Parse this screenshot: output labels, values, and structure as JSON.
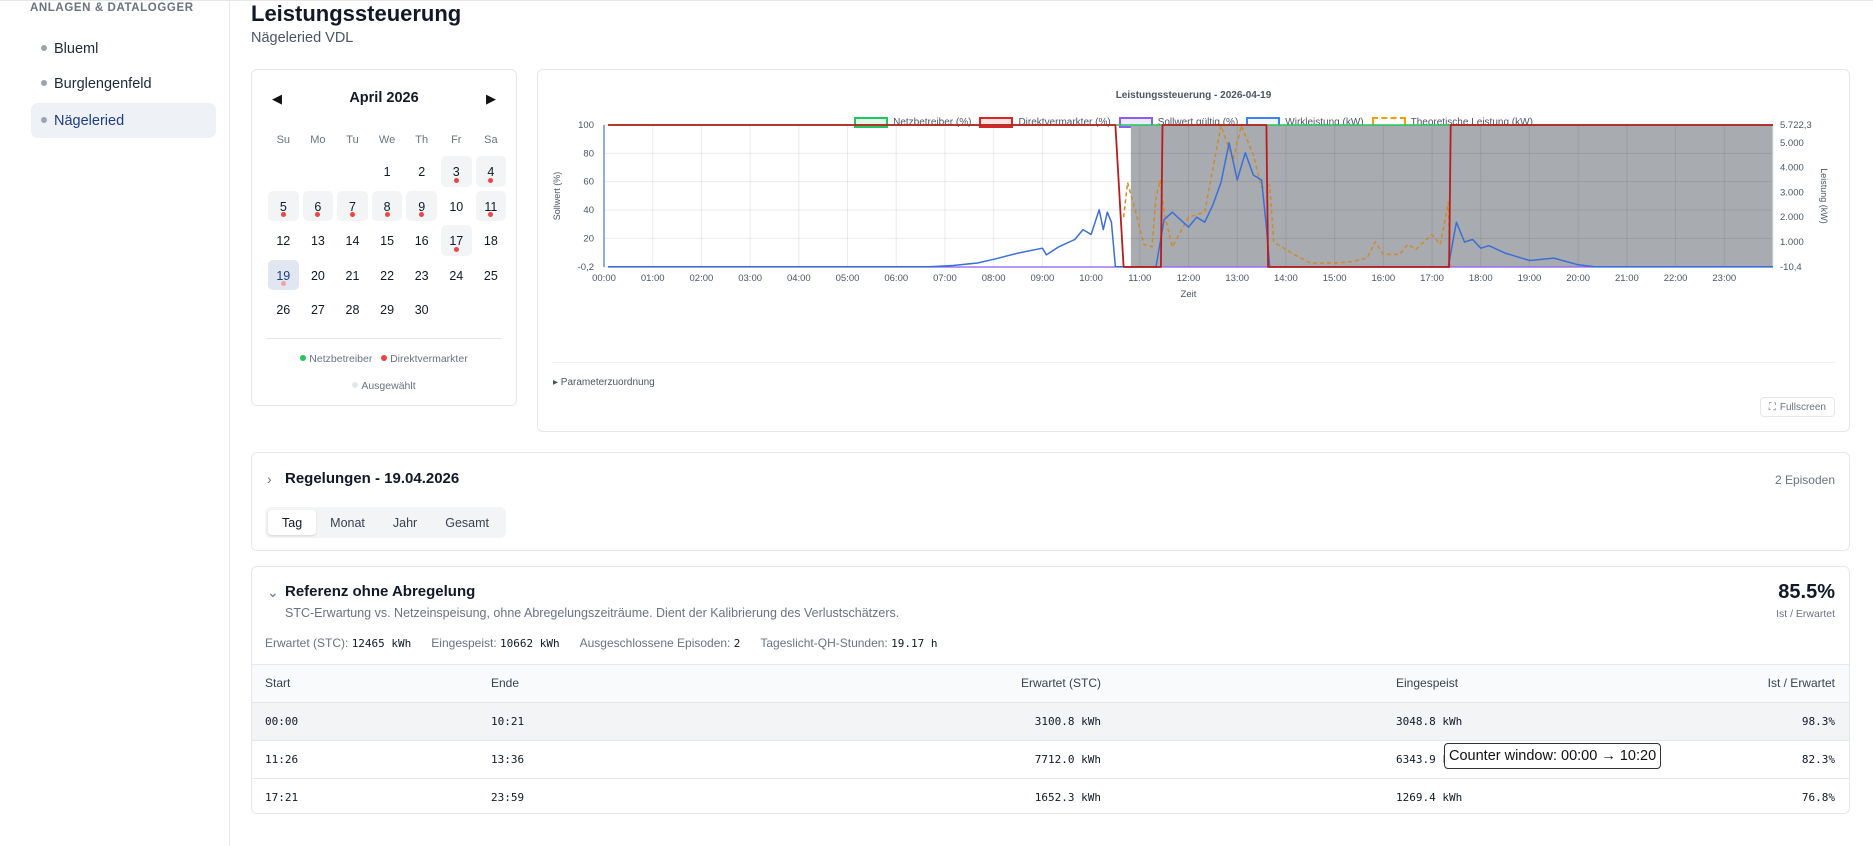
{
  "sidebar": {
    "heading": "ANLAGEN & DATALOGGER",
    "items": [
      {
        "label": "Blueml"
      },
      {
        "label": "Burglengenfeld"
      },
      {
        "label": "Nägeleried"
      }
    ]
  },
  "header": {
    "title": "Leistungssteuerung",
    "subtitle": "Nägeleried VDL"
  },
  "calendar": {
    "month": "April 2026",
    "prev": "◀",
    "next": "▶",
    "weekdays": [
      "Su",
      "Mo",
      "Tu",
      "We",
      "Th",
      "Fr",
      "Sa"
    ],
    "legend": {
      "netz": "Netzbetreiber",
      "direkt": "Direktvermarkter",
      "sel": "Ausgewählt"
    },
    "colors": {
      "netz": "#22c55e",
      "direkt": "#ef4444"
    }
  },
  "chart": {
    "title": "Leistungssteuerung - 2026-04-19",
    "param_toggle": "▸ Parameterzuordnung",
    "fullscreen": "Fullscreen",
    "legend": [
      {
        "name": "Netzbetreiber (%)",
        "color": "#22c55e",
        "fill": "#dcfce7",
        "dash": false
      },
      {
        "name": "Direktvermarkter (%)",
        "color": "#dc2626",
        "fill": "#fee2e2",
        "dash": false
      },
      {
        "name": "Sollwert gültig (%)",
        "color": "#8b5cf6",
        "fill": "#ede9fe",
        "dash": false
      },
      {
        "name": "Wirkleistung (kW)",
        "color": "#3b82f6",
        "fill": "#eff6ff",
        "dash": false
      },
      {
        "name": "Theoretische Leistung (kW)",
        "color": "#f59e0b",
        "fill": "#fff",
        "dash": true
      }
    ]
  },
  "chart_data": {
    "type": "line",
    "title": "Leistungssteuerung - 2026-04-19",
    "xlabel": "Zeit",
    "ylabel": "Sollwert (%)",
    "y2label": "Leistung (kW)",
    "x_ticks": [
      "00:00",
      "01:00",
      "02:00",
      "03:00",
      "04:00",
      "05:00",
      "06:00",
      "07:00",
      "08:00",
      "09:00",
      "10:00",
      "11:00",
      "12:00",
      "13:00",
      "14:00",
      "15:00",
      "16:00",
      "17:00",
      "18:00",
      "19:00",
      "20:00",
      "21:00",
      "22:00",
      "23:00"
    ],
    "y_ticks": [
      "100",
      "80",
      "60",
      "40",
      "20",
      "-0,2"
    ],
    "y2_ticks": [
      "5.722,3",
      "5.000",
      "4.000",
      "3.000",
      "2.000",
      "1.000",
      "-10,4"
    ],
    "ylim": [
      -0.2,
      100
    ],
    "y2lim": [
      -10.4,
      5722.3
    ],
    "grid": true,
    "legend_position": "top",
    "shaded_interval": [
      "10:49",
      "24:00"
    ],
    "series": [
      {
        "name": "Netzbetreiber (%)",
        "points": [
          [
            "00:05",
            100
          ],
          [
            "24:00",
            100
          ]
        ]
      },
      {
        "name": "Direktvermarkter (%)",
        "points": [
          [
            "00:05",
            100
          ],
          [
            "10:30",
            100
          ],
          [
            "10:40",
            -0.2
          ],
          [
            "11:26",
            -0.2
          ],
          [
            "11:28",
            100
          ],
          [
            "13:36",
            100
          ],
          [
            "13:38",
            -0.2
          ],
          [
            "17:21",
            -0.2
          ],
          [
            "17:23",
            100
          ],
          [
            "24:00",
            100
          ]
        ]
      },
      {
        "name": "Sollwert gültig (%)",
        "points": [
          [
            "00:05",
            -0.2
          ],
          [
            "24:00",
            -0.2
          ]
        ]
      },
      {
        "name": "Wirkleistung (kW)",
        "points": [
          [
            "00:05",
            0
          ],
          [
            "06:40",
            0
          ],
          [
            "07:10",
            50
          ],
          [
            "07:40",
            150
          ],
          [
            "08:00",
            300
          ],
          [
            "08:30",
            550
          ],
          [
            "09:00",
            750
          ],
          [
            "09:05",
            480
          ],
          [
            "09:20",
            800
          ],
          [
            "09:40",
            1100
          ],
          [
            "09:50",
            1500
          ],
          [
            "10:00",
            1300
          ],
          [
            "10:10",
            2300
          ],
          [
            "10:15",
            1500
          ],
          [
            "10:20",
            2200
          ],
          [
            "10:25",
            1800
          ],
          [
            "10:30",
            0
          ],
          [
            "11:20",
            0
          ],
          [
            "11:30",
            1900
          ],
          [
            "11:40",
            2200
          ],
          [
            "11:50",
            1900
          ],
          [
            "12:00",
            1600
          ],
          [
            "12:10",
            2000
          ],
          [
            "12:20",
            1800
          ],
          [
            "12:30",
            2500
          ],
          [
            "12:40",
            3400
          ],
          [
            "12:50",
            5000
          ],
          [
            "13:00",
            3500
          ],
          [
            "13:10",
            4600
          ],
          [
            "13:20",
            3700
          ],
          [
            "13:30",
            3500
          ],
          [
            "13:36",
            1600
          ],
          [
            "13:40",
            0
          ],
          [
            "17:20",
            0
          ],
          [
            "17:30",
            1800
          ],
          [
            "17:40",
            1000
          ],
          [
            "17:50",
            1100
          ],
          [
            "18:00",
            750
          ],
          [
            "18:10",
            850
          ],
          [
            "18:30",
            550
          ],
          [
            "19:00",
            250
          ],
          [
            "19:30",
            350
          ],
          [
            "20:00",
            80
          ],
          [
            "20:20",
            0
          ],
          [
            "24:00",
            0
          ]
        ]
      },
      {
        "name": "Theoretische Leistung (kW)",
        "points": [
          [
            "10:40",
            2000
          ],
          [
            "10:45",
            3400
          ],
          [
            "10:55",
            2200
          ],
          [
            "11:05",
            900
          ],
          [
            "11:15",
            800
          ],
          [
            "11:20",
            2800
          ],
          [
            "11:25",
            3500
          ],
          [
            "11:30",
            2200
          ],
          [
            "11:40",
            800
          ],
          [
            "12:00",
            2000
          ],
          [
            "12:20",
            2200
          ],
          [
            "12:40",
            5700
          ],
          [
            "12:55",
            4300
          ],
          [
            "13:05",
            5700
          ],
          [
            "13:20",
            4500
          ],
          [
            "13:30",
            3200
          ],
          [
            "13:40",
            3300
          ],
          [
            "13:45",
            1000
          ],
          [
            "14:00",
            700
          ],
          [
            "14:10",
            500
          ],
          [
            "14:30",
            150
          ],
          [
            "15:00",
            150
          ],
          [
            "15:20",
            200
          ],
          [
            "15:40",
            350
          ],
          [
            "15:50",
            1000
          ],
          [
            "16:00",
            500
          ],
          [
            "16:20",
            500
          ],
          [
            "16:30",
            900
          ],
          [
            "16:40",
            700
          ],
          [
            "17:00",
            1300
          ],
          [
            "17:10",
            900
          ],
          [
            "17:15",
            1700
          ],
          [
            "17:20",
            2600
          ],
          [
            "17:22",
            0
          ]
        ]
      }
    ]
  },
  "regelungen": {
    "title": "Regelungen - 19.04.2026",
    "count": "2 Episoden",
    "tabs": [
      "Tag",
      "Monat",
      "Jahr",
      "Gesamt"
    ]
  },
  "referenz": {
    "title": "Referenz ohne Abregelung",
    "desc": "STC-Erwartung vs. Netzeinspeisung, ohne Abregelungszeiträume. Dient der Kalibrierung des Verlustschätzers.",
    "pct": "85.5%",
    "pct_label": "Ist / Erwartet",
    "stats": [
      {
        "label": "Erwartet (STC):",
        "value": "12465 kWh"
      },
      {
        "label": "Eingespeist:",
        "value": "10662 kWh"
      },
      {
        "label": "Ausgeschlossene Episoden:",
        "value": "2"
      },
      {
        "label": "Tageslicht-QH-Stunden:",
        "value": "19.17 h"
      }
    ],
    "columns": [
      "Start",
      "Ende",
      "Erwartet (STC)",
      "Eingespeist",
      "Ist / Erwartet"
    ],
    "rows": [
      [
        "00:00",
        "10:21",
        "3100.8 kWh",
        "3048.8 kWh",
        "98.3%"
      ],
      [
        "11:26",
        "13:36",
        "7712.0 kWh",
        "6343.9 kWh",
        "82.3%"
      ],
      [
        "17:21",
        "23:59",
        "1652.3 kWh",
        "1269.4 kWh",
        "76.8%"
      ]
    ],
    "tooltip": "Counter window: 00:00 → 10:20"
  }
}
